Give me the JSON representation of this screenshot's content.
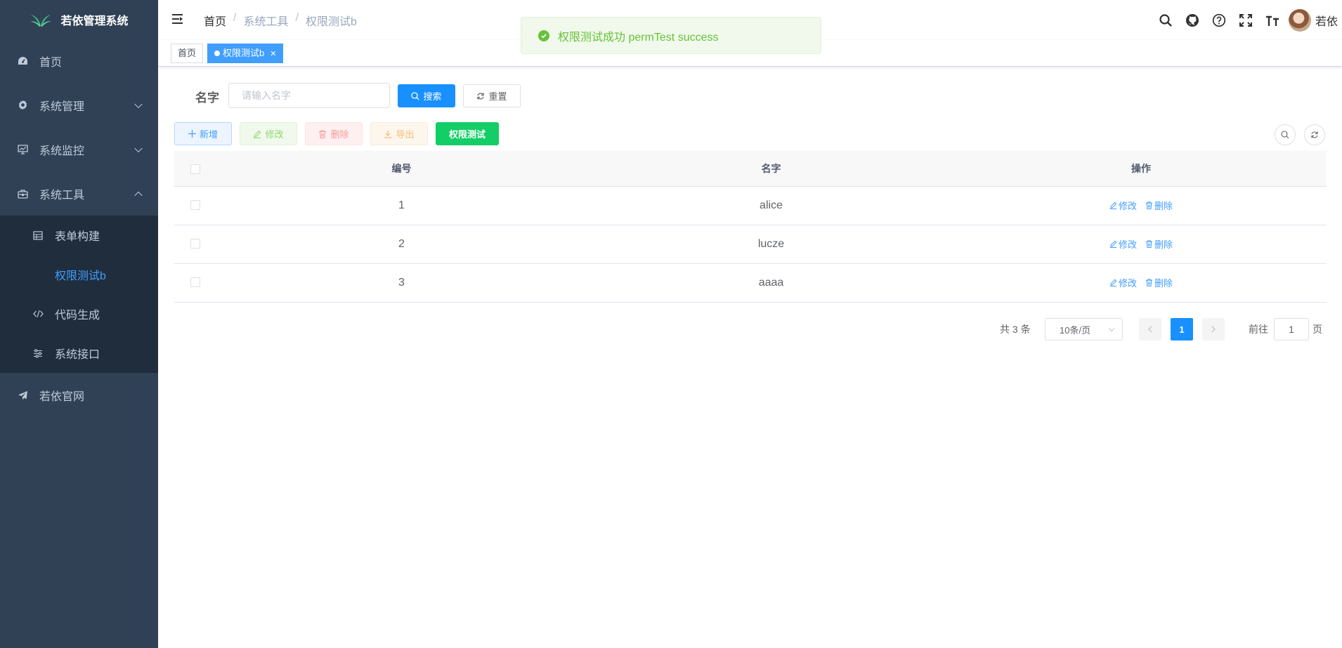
{
  "sidebar": {
    "logo_title": "若依管理系统",
    "items": [
      {
        "label": "首页",
        "icon": "dashboard-icon"
      },
      {
        "label": "系统管理",
        "icon": "gear-icon"
      },
      {
        "label": "系统监控",
        "icon": "monitor-icon"
      },
      {
        "label": "系统工具",
        "icon": "toolbox-icon"
      }
    ],
    "sub_items": [
      {
        "label": "表单构建",
        "icon": "table-icon"
      },
      {
        "label": "权限测试b",
        "icon": ""
      },
      {
        "label": "代码生成",
        "icon": "code-icon"
      },
      {
        "label": "系统接口",
        "icon": "sliders-icon"
      }
    ],
    "external": {
      "label": "若依官网",
      "icon": "send-icon"
    }
  },
  "navbar": {
    "breadcrumb": [
      "首页",
      "系统工具",
      "权限测试b"
    ],
    "user_name": "若依",
    "icons": [
      "search-icon",
      "github-icon",
      "help-icon",
      "fullscreen-icon",
      "font-size-icon"
    ]
  },
  "tags": {
    "items": [
      {
        "label": "首页",
        "active": false
      },
      {
        "label": "权限测试b",
        "active": true
      }
    ]
  },
  "toast": {
    "message": "权限测试成功 permTest success",
    "type": "success"
  },
  "search": {
    "label": "名字",
    "placeholder": "请输入名字",
    "search_label": "搜索",
    "reset_label": "重置"
  },
  "toolbar": {
    "add_label": "新增",
    "edit_label": "修改",
    "delete_label": "删除",
    "export_label": "导出",
    "perm_test_label": "权限测试"
  },
  "table": {
    "columns": [
      "编号",
      "名字",
      "操作"
    ],
    "rows": [
      {
        "id": "1",
        "name": "alice"
      },
      {
        "id": "2",
        "name": "lucze"
      },
      {
        "id": "3",
        "name": "aaaa"
      }
    ],
    "op_edit": "修改",
    "op_delete": "删除"
  },
  "pagination": {
    "total": "共 3 条",
    "page_size": "10条/页",
    "current_page": "1",
    "goto_label": "前往",
    "goto_value": "1",
    "page_suffix": "页"
  },
  "colors": {
    "sidebar_bg": "#304156",
    "submenu_bg": "#1f2d3d",
    "primary": "#1890ff",
    "success": "#13ce66"
  }
}
